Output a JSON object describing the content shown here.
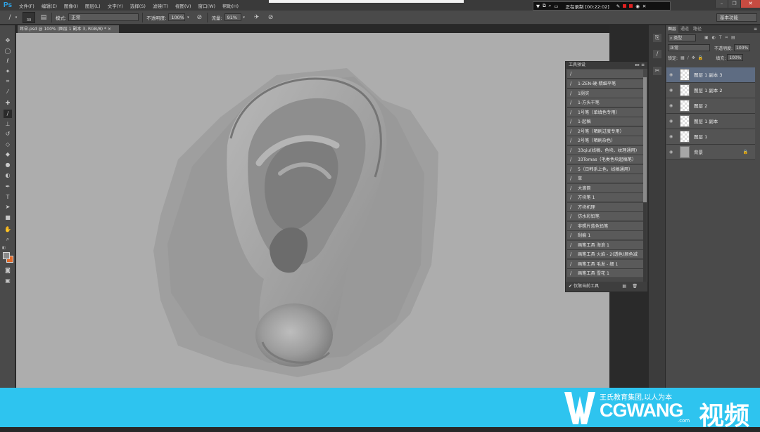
{
  "app": {
    "logo": "Ps"
  },
  "menu": [
    "文件(F)",
    "编辑(E)",
    "图像(I)",
    "图层(L)",
    "文字(Y)",
    "选择(S)",
    "滤镜(T)",
    "视图(V)",
    "窗口(W)",
    "帮助(H)"
  ],
  "recording": {
    "label": "正在录制 [00:22:02]"
  },
  "options": {
    "brush_size": "30",
    "mode_label": "模式:",
    "mode_value": "正常",
    "opacity_label": "不透明度:",
    "opacity_value": "100%",
    "flow_label": "流量:",
    "flow_value": "91%",
    "workspace": "基本功能"
  },
  "document": {
    "tab": "耳朵.psd @ 100% (图层 1 副本 3, RGB/8) *"
  },
  "presets": {
    "title": "工具预设",
    "items": [
      "1-ZEN-硬-精细平笔",
      "1厕实",
      "1-方头干笔",
      "1号笔（单填色专用）",
      "1-起稿",
      "2号笔（晒刷过度专用）",
      "2号笔（晒刷杂色）",
      "33qiu(线稿、色块、纹理通用)",
      "33Tomas（毛类色块起稿笔）",
      "5（日韩系上色，线稿通用）",
      "草",
      "大滚筒",
      "方块笔 1",
      "方块机理",
      "仿水彩铅笔",
      "非照片蓝色铅笔",
      "刮痕 1",
      "画笔工具 海浪 1",
      "画笔工具 火焰 - 2(透色)颜色减",
      "画笔工具 毛发 - 细 1",
      "画笔工具 雪花 1",
      "画笔工具 - 浮雪 2"
    ],
    "footer": "仅限当前工具"
  },
  "layers": {
    "tabs": [
      "图层",
      "通道",
      "路径"
    ],
    "filter": "类型",
    "blend": "正常",
    "opacity_label": "不透明度:",
    "opacity": "100%",
    "lock_label": "锁定:",
    "fill_label": "填充:",
    "fill": "100%",
    "items": [
      "图层 1 副本 3",
      "图层 1 副本 2",
      "图层 2",
      "图层 1 副本",
      "图层 1",
      "背景"
    ]
  },
  "banner": {
    "slogan": "王氏教育集团,以人为本",
    "brand": "CGWANG",
    "com": ".com",
    "video": "视频"
  },
  "colors": {
    "brand": "#2ec4ef",
    "foreground_swatch": "#8a8a8a",
    "background_swatch": "#e06a2a"
  }
}
